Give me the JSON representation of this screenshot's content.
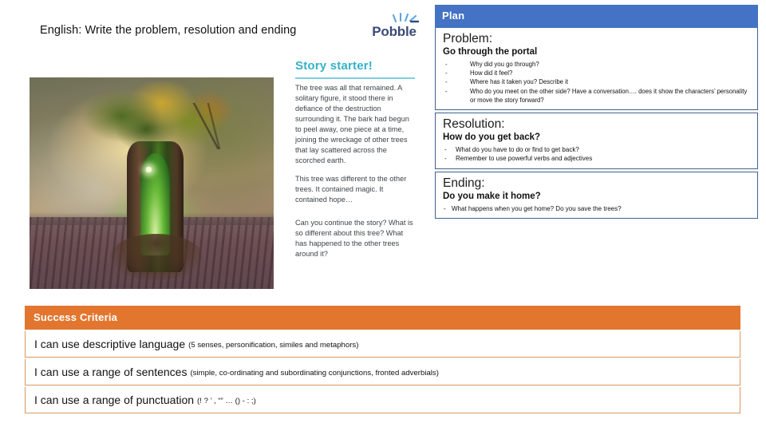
{
  "header": {
    "lesson_title": "English: Write the problem, resolution and ending",
    "logo_wordmark": "Pobble",
    "logo_icon": "sparkle-icon"
  },
  "story_starter": {
    "title": "Story starter!",
    "paragraphs": [
      "The tree was all that remained. A solitary figure, it stood there in defiance of the destruction surrounding it. The bark had begun to peel away, one piece at a time, joining the wreckage of other trees that lay scattered across the scorched earth.",
      "This tree was different to the other trees. It contained magic. It contained hope…",
      "Can you continue the story? What is so different about this tree? What has happened to the other trees around it?"
    ]
  },
  "photo": {
    "alt_name": "magic-tree-portal-image"
  },
  "plan": {
    "header": "Plan",
    "sections": [
      {
        "heading": "Problem:",
        "subheading": "Go through the portal",
        "bullets": [
          "Why did you go through?",
          "How did it feel?",
          "Where has it taken you? Describe it",
          "Who do you meet on the other side? Have a conversation…. does it show the characters’ personality or move the story forward?"
        ]
      },
      {
        "heading": "Resolution:",
        "subheading": "How do you get back?",
        "bullets": [
          "What do you have to do or find to get back?",
          "Remember to use powerful verbs and adjectives"
        ]
      },
      {
        "heading": "Ending:",
        "subheading": "Do you make it home?",
        "bullets": [
          "What happens when you get home? Do you save the trees?"
        ]
      }
    ]
  },
  "success_criteria": {
    "header": "Success Criteria",
    "rows": [
      {
        "main": "I can use descriptive language",
        "note": "(5 senses, personification, similes and metaphors)"
      },
      {
        "main": "I can use a range of sentences",
        "note": "(simple, co-ordinating and subordinating conjunctions, fronted adverbials)"
      },
      {
        "main": "I can use a range of punctuation",
        "note": "(! ? ’ , “” … () - : ;)"
      }
    ]
  },
  "colors": {
    "plan_blue": "#4472C4",
    "criteria_orange": "#E2762F",
    "story_starter_teal": "#34B2C6",
    "logo_navy": "#3B4A78"
  }
}
